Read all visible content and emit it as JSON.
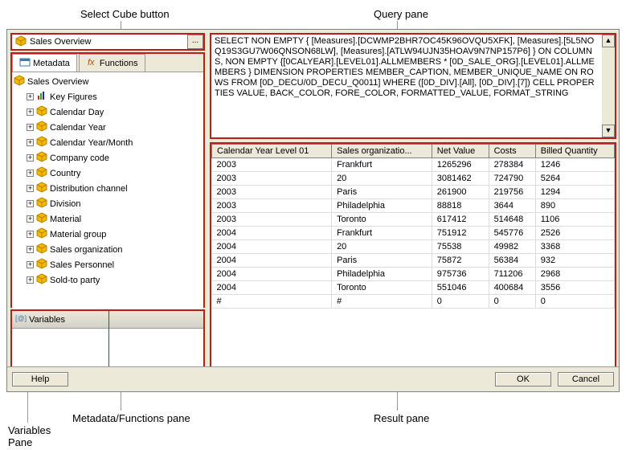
{
  "labels": {
    "select_cube": "Select Cube button",
    "query_pane": "Query pane",
    "meta_pane": "Metadata/Functions pane",
    "result_pane": "Result pane",
    "vars_pane": "Variables",
    "vars_pane2": "Pane"
  },
  "cube": {
    "name": "Sales Overview",
    "ellipsis": "..."
  },
  "tabs": {
    "metadata": "Metadata",
    "functions": "Functions"
  },
  "tree": {
    "root": "Sales Overview",
    "items": [
      "Key Figures",
      "Calendar Day",
      "Calendar Year",
      "Calendar Year/Month",
      "Company code",
      "Country",
      "Distribution channel",
      "Division",
      "Material",
      "Material group",
      "Sales organization",
      "Sales Personnel",
      "Sold-to party"
    ]
  },
  "vars": {
    "title": "Variables"
  },
  "query": {
    "text": "SELECT NON EMPTY { [Measures].[DCWMP2BHR7OC45K96OVQU5XFK], [Measures].[5L5NOQ19S3GU7W06QNSON68LW], [Measures].[ATLW94UJN35HOAV9N7NP157P6] } ON COLUMNS, NON EMPTY {[0CALYEAR].[LEVEL01].ALLMEMBERS * [0D_SALE_ORG].[LEVEL01].ALLMEMBERS } DIMENSION PROPERTIES MEMBER_CAPTION, MEMBER_UNIQUE_NAME ON ROWS FROM [0D_DECU/0D_DECU_Q0011] WHERE ([0D_DIV].[All], [0D_DIV].[7]) CELL PROPERTIES VALUE, BACK_COLOR, FORE_COLOR, FORMATTED_VALUE, FORMAT_STRING"
  },
  "chart_data": {
    "type": "table",
    "columns": [
      "Calendar Year Level 01",
      "Sales organizatio...",
      "Net Value",
      "Costs",
      "Billed Quantity"
    ],
    "rows": [
      [
        "2003",
        "Frankfurt",
        "1265296",
        "278384",
        "1246"
      ],
      [
        "2003",
        "20",
        "3081462",
        "724790",
        "5264"
      ],
      [
        "2003",
        "Paris",
        "261900",
        "219756",
        "1294"
      ],
      [
        "2003",
        "Philadelphia",
        "88818",
        "3644",
        "890"
      ],
      [
        "2003",
        "Toronto",
        "617412",
        "514648",
        "1106"
      ],
      [
        "2004",
        "Frankfurt",
        "751912",
        "545776",
        "2526"
      ],
      [
        "2004",
        "20",
        "75538",
        "49982",
        "3368"
      ],
      [
        "2004",
        "Paris",
        "75872",
        "56384",
        "932"
      ],
      [
        "2004",
        "Philadelphia",
        "975736",
        "711206",
        "2968"
      ],
      [
        "2004",
        "Toronto",
        "551046",
        "400684",
        "3556"
      ],
      [
        "#",
        "#",
        "0",
        "0",
        "0"
      ]
    ]
  },
  "footer": {
    "help": "Help",
    "ok": "OK",
    "cancel": "Cancel"
  }
}
